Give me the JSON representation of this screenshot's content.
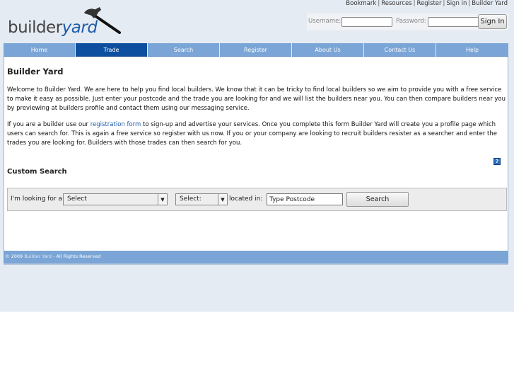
{
  "top_links": [
    "Bookmark",
    "Resources",
    "Register",
    "Sign in",
    "Builder Yard"
  ],
  "logo": {
    "builder": "builder",
    "yard": "yard"
  },
  "login": {
    "username_label": "Username:",
    "password_label": "Password:",
    "username_value": "",
    "password_value": "",
    "signin_label": "Sign In"
  },
  "nav": [
    {
      "label": "Home"
    },
    {
      "label": "Trade"
    },
    {
      "label": "Search"
    },
    {
      "label": "Register"
    },
    {
      "label": "About Us"
    },
    {
      "label": "Contact Us"
    },
    {
      "label": "Help"
    }
  ],
  "nav_active": "Trade",
  "page_title": "Builder Yard",
  "intro": "Welcome to Builder Yard. We are here to help you find local builders. We know that it can be tricky to find local builders so we aim to provide you with a free service to make it easy as possible. Just enter your postcode and the trade you are looking for and we will list the builders near you. You can then compare builders near you by previewing at builders profile and contact them using our messaging service.",
  "builder_para": {
    "before": "If you are a builder use our ",
    "link": "registration form",
    "after": " to sign-up and advertise your services. Once you complete this form Builder Yard will create you a profile page which users can search for. This is again a free service so register with us now. If you or your company are looking to recruit builders resister as a searcher and enter the trades you are looking for. Builders with those trades can then search for you."
  },
  "help_icon_glyph": "?",
  "custom_search": {
    "title": "Custom Search",
    "looking_for_label": "I'm looking for a:",
    "select1_value": "Select",
    "select2_value": "Select:",
    "located_label": "located in:",
    "postcode_value": "Type Postcode",
    "search_label": "Search"
  },
  "footer": {
    "copyright": "© 2009 ",
    "brand": "Builder Yard",
    "rest": " - All Rights Reserved"
  },
  "colors": {
    "nav": "#7aa5d6",
    "nav_active": "#0d4f9e",
    "link": "#1e5aa8",
    "page_bg": "#e5ebf3"
  }
}
